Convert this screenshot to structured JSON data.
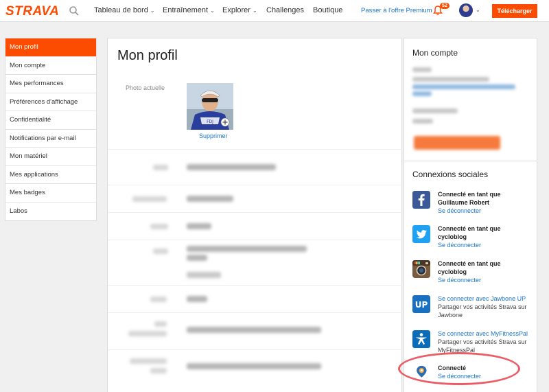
{
  "brand": {
    "name": "STRAVA",
    "accent": "#fc4c02",
    "link_color": "#1a73c9"
  },
  "topnav": {
    "items": [
      {
        "label": "Tableau de bord",
        "has_menu": true
      },
      {
        "label": "Entraînement",
        "has_menu": true
      },
      {
        "label": "Explorer",
        "has_menu": true
      },
      {
        "label": "Challenges",
        "has_menu": false
      },
      {
        "label": "Boutique",
        "has_menu": false
      }
    ],
    "premium_link": "Passer à l'offre Premium",
    "notification_count": "52",
    "download_button": "Télécharger"
  },
  "sidebar": {
    "items": [
      {
        "label": "Mon profil",
        "active": true
      },
      {
        "label": "Mon compte",
        "active": false
      },
      {
        "label": "Mes performances",
        "active": false
      },
      {
        "label": "Préférences d'affichage",
        "active": false
      },
      {
        "label": "Confidentialité",
        "active": false
      },
      {
        "label": "Notifications par e-mail",
        "active": false
      },
      {
        "label": "Mon matériel",
        "active": false
      },
      {
        "label": "Mes applications",
        "active": false
      },
      {
        "label": "Mes badges",
        "active": false
      },
      {
        "label": "Labos",
        "active": false
      }
    ]
  },
  "main": {
    "title": "Mon profil",
    "photo_label": "Photo actuelle",
    "remove_photo": "Supprimer"
  },
  "account": {
    "title": "Mon compte"
  },
  "social": {
    "title": "Connexions sociales",
    "items": [
      {
        "service": "facebook",
        "icon": "facebook-icon",
        "color": "#3b5998",
        "line1": "Connecté en tant que",
        "line2": "Guillaume Robert",
        "link": "Se déconnecter"
      },
      {
        "service": "twitter",
        "icon": "twitter-icon",
        "color": "#1da1f2",
        "line1": "Connecté en tant que",
        "line2": "cycloblog",
        "link": "Se déconnecter"
      },
      {
        "service": "instagram",
        "icon": "instagram-icon",
        "color": "#7a5a3c",
        "line1": "Connecté en tant que",
        "line2": "cycloblog",
        "link": "Se déconnecter"
      },
      {
        "service": "jawbone",
        "icon": "jawbone-up-icon",
        "color": "#1a6fc0",
        "link": "Se connecter avec Jawbone UP",
        "desc": "Partager vos activités Strava sur Jawbone"
      },
      {
        "service": "myfitnesspal",
        "icon": "myfitnesspal-icon",
        "color": "#0b6cb7",
        "link": "Se connecter avec MyFitnessPal",
        "desc": "Partager vos activités Strava sur MyFitnessPal"
      },
      {
        "service": "other",
        "icon": "location-pin-icon",
        "color": "#2a6db5",
        "line1": "Connecté",
        "link": "Se déconnecter"
      }
    ]
  }
}
